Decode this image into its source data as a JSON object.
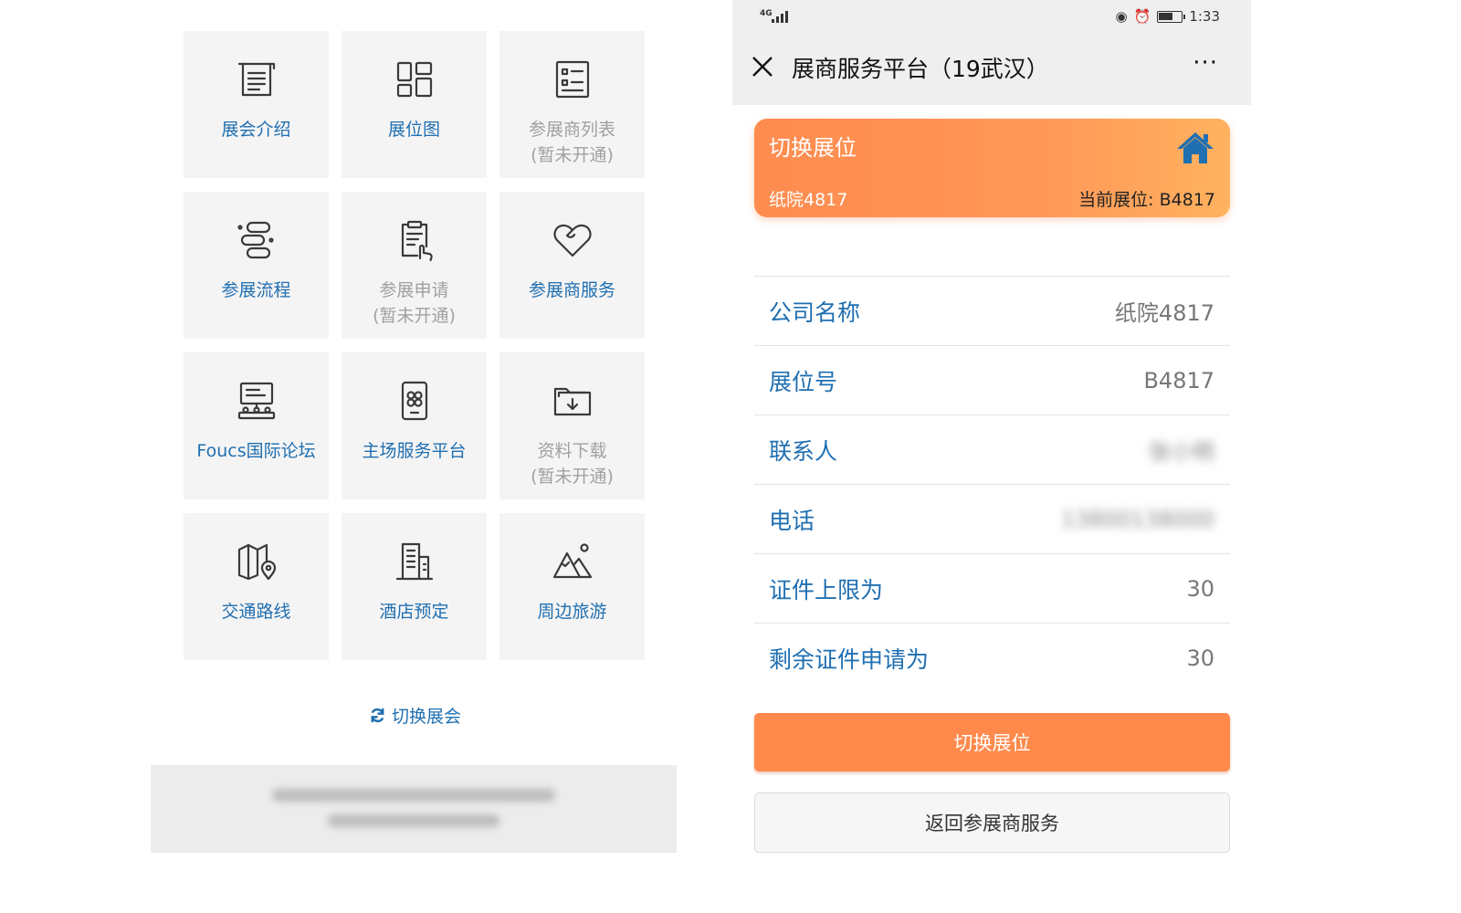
{
  "left_panel": {
    "tiles": [
      {
        "label": "展会介绍",
        "sub": "",
        "icon": "document-list-icon",
        "disabled": false
      },
      {
        "label": "展位图",
        "sub": "",
        "icon": "layout-grid-icon",
        "disabled": false
      },
      {
        "label": "参展商列表",
        "sub": "(暂未开通)",
        "icon": "exhibitor-list-icon",
        "disabled": true
      },
      {
        "label": "参展流程",
        "sub": "",
        "icon": "process-flow-icon",
        "disabled": false
      },
      {
        "label": "参展申请",
        "sub": "(暂未开通)",
        "icon": "application-form-icon",
        "disabled": true
      },
      {
        "label": "参展商服务",
        "sub": "",
        "icon": "heart-service-icon",
        "disabled": false
      },
      {
        "label": "Foucs国际论坛",
        "sub": "",
        "icon": "forum-podium-icon",
        "disabled": false
      },
      {
        "label": "主场服务平台",
        "sub": "",
        "icon": "service-platform-icon",
        "disabled": false
      },
      {
        "label": "资料下载",
        "sub": "(暂未开通)",
        "icon": "folder-download-icon",
        "disabled": true
      },
      {
        "label": "交通路线",
        "sub": "",
        "icon": "map-route-icon",
        "disabled": false
      },
      {
        "label": "酒店预定",
        "sub": "",
        "icon": "hotel-building-icon",
        "disabled": false
      },
      {
        "label": "周边旅游",
        "sub": "",
        "icon": "mountain-travel-icon",
        "disabled": false
      }
    ],
    "switch_fair_label": "切换展会"
  },
  "phone": {
    "status": {
      "network": "4G",
      "time": "1:33"
    },
    "nav": {
      "title": "展商服务平台（19武汉）",
      "more": "···"
    },
    "booth_card": {
      "title": "切换展位",
      "company": "纸院4817",
      "current_booth": "当前展位: B4817"
    },
    "info_rows": [
      {
        "key": "公司名称",
        "value": "纸院4817",
        "redacted": false
      },
      {
        "key": "展位号",
        "value": "B4817",
        "redacted": false
      },
      {
        "key": "联系人",
        "value": "张小明",
        "redacted": true
      },
      {
        "key": "电话",
        "value": "13800138000",
        "redacted": true
      },
      {
        "key": "证件上限为",
        "value": "30",
        "redacted": false
      },
      {
        "key": "剩余证件申请为",
        "value": "30",
        "redacted": false
      }
    ],
    "primary_button": "切换展位",
    "secondary_button": "返回参展商服务"
  },
  "colors": {
    "accent_blue": "#1f6fb1",
    "accent_orange": "#ff8a4c",
    "tile_bg": "#f5f4f4"
  }
}
